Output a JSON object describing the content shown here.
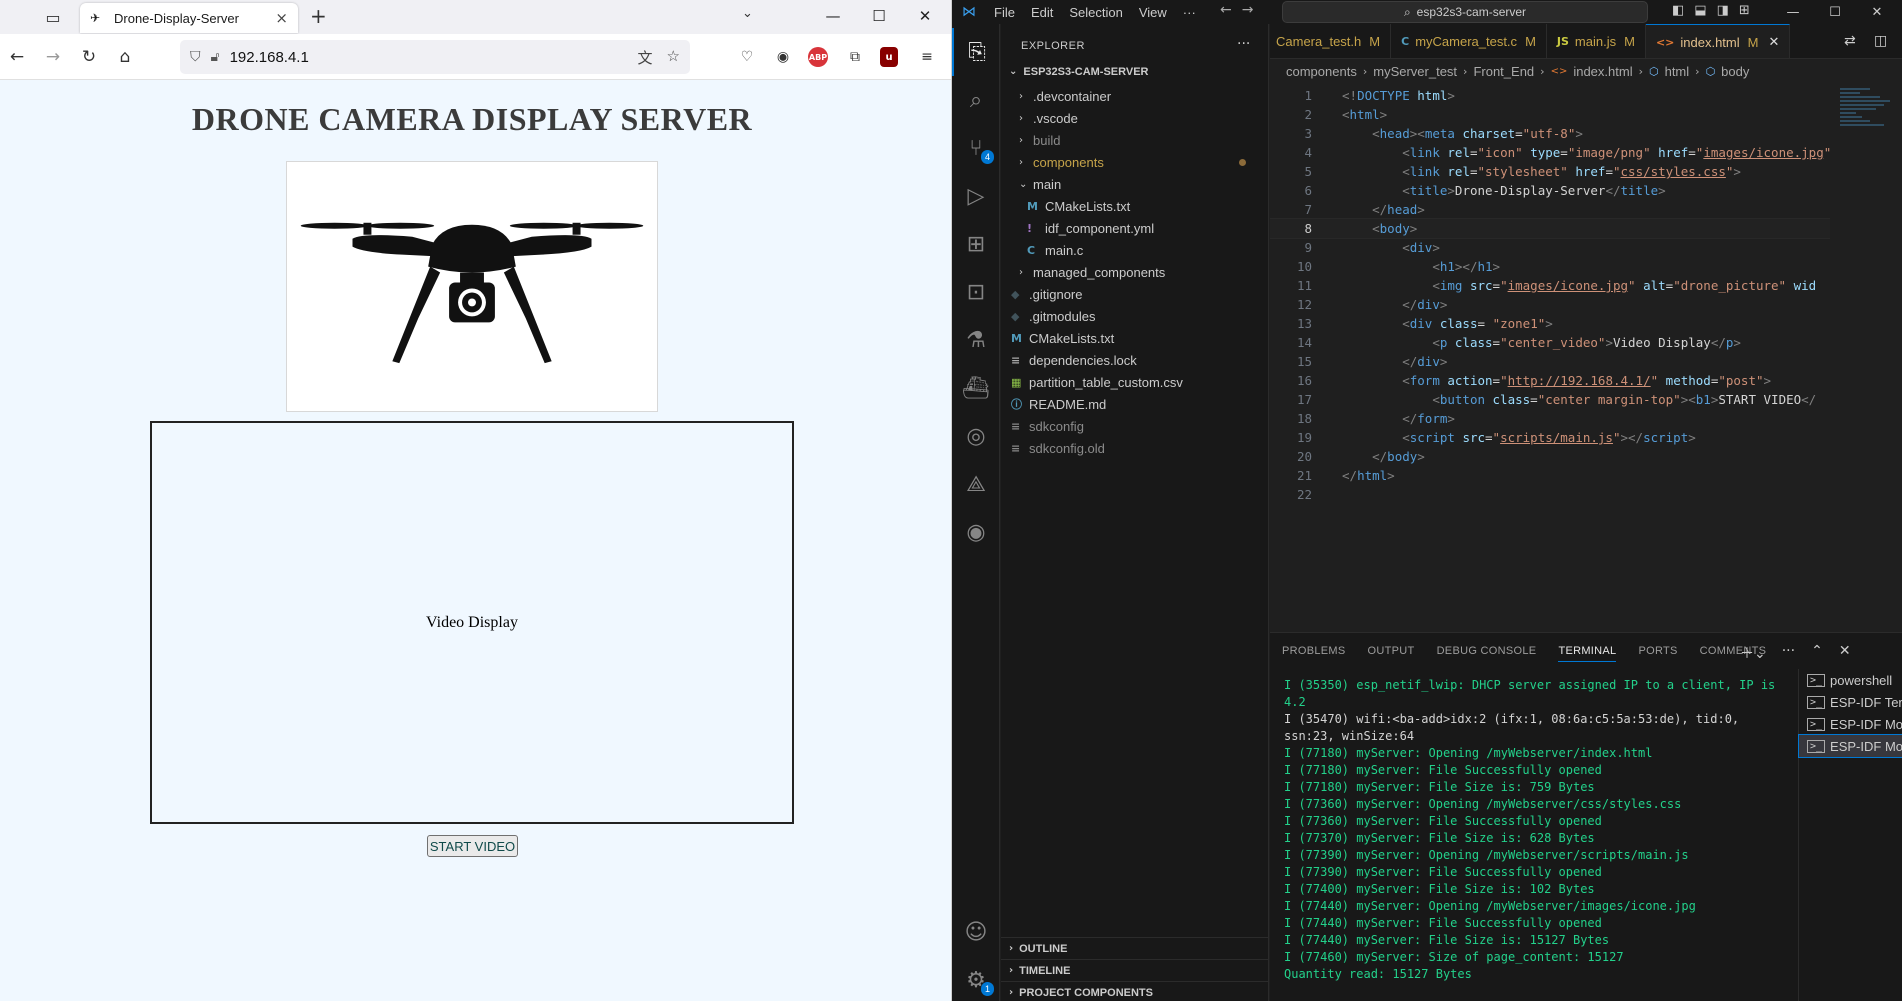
{
  "browser": {
    "tab_title": "Drone-Display-Server",
    "url": "192.168.4.1",
    "page": {
      "heading": "DRONE CAMERA DISPLAY SERVER",
      "video_text": "Video Display",
      "button_label": "START VIDEO"
    }
  },
  "vscode": {
    "menu": [
      "File",
      "Edit",
      "Selection",
      "View",
      "···"
    ],
    "command_center": "esp32s3-cam-server",
    "explorer": {
      "title": "EXPLORER",
      "root": "ESP32S3-CAM-SERVER",
      "items": [
        {
          "label": ".devcontainer",
          "type": "folder"
        },
        {
          "label": ".vscode",
          "type": "folder"
        },
        {
          "label": "build",
          "type": "folder"
        },
        {
          "label": "components",
          "type": "folder"
        },
        {
          "label": "main",
          "type": "folder-open"
        },
        {
          "label": "CMakeLists.txt",
          "type": "file",
          "icon": "M"
        },
        {
          "label": "idf_component.yml",
          "type": "file",
          "icon": "!"
        },
        {
          "label": "main.c",
          "type": "file",
          "icon": "C"
        },
        {
          "label": "managed_components",
          "type": "folder"
        },
        {
          "label": ".gitignore",
          "type": "file",
          "icon": "◆"
        },
        {
          "label": ".gitmodules",
          "type": "file",
          "icon": "◆"
        },
        {
          "label": "CMakeLists.txt",
          "type": "file",
          "icon": "M"
        },
        {
          "label": "dependencies.lock",
          "type": "file",
          "icon": "≡"
        },
        {
          "label": "partition_table_custom.csv",
          "type": "file",
          "icon": "▦"
        },
        {
          "label": "README.md",
          "type": "file",
          "icon": "ⓘ"
        },
        {
          "label": "sdkconfig",
          "type": "file",
          "icon": "≡"
        },
        {
          "label": "sdkconfig.old",
          "type": "file",
          "icon": "≡"
        }
      ],
      "sections": [
        "OUTLINE",
        "TIMELINE",
        "PROJECT COMPONENTS"
      ]
    },
    "badges": {
      "source_control": "4",
      "settings": "1"
    },
    "tabs": [
      {
        "label": "Camera_test.h",
        "icon": "",
        "status": "M"
      },
      {
        "label": "myCamera_test.c",
        "icon": "C",
        "status": "M"
      },
      {
        "label": "main.js",
        "icon": "JS",
        "status": "M"
      },
      {
        "label": "index.html",
        "icon": "<>",
        "status": "M"
      }
    ],
    "breadcrumb": [
      "components",
      "myServer_test",
      "Front_End",
      "index.html",
      "html",
      "body"
    ],
    "code_lines": [
      {
        "n": "1",
        "html": "<span class='ba'>&lt;!</span><span class='tg'>DOCTYPE</span> <span class='at'>html</span><span class='ba'>&gt;</span>"
      },
      {
        "n": "2",
        "html": "<span class='ba'>&lt;</span><span class='tg'>html</span><span class='ba'>&gt;</span>"
      },
      {
        "n": "3",
        "html": "    <span class='ba'>&lt;</span><span class='tg'>head</span><span class='ba'>&gt;&lt;</span><span class='tg'>meta</span> <span class='at'>charset</span><span class='tx'>=</span><span class='sv'>\"utf-8\"</span><span class='ba'>&gt;</span>"
      },
      {
        "n": "4",
        "html": "        <span class='ba'>&lt;</span><span class='tg'>link</span> <span class='at'>rel</span><span class='tx'>=</span><span class='sv'>\"icon\"</span> <span class='at'>type</span><span class='tx'>=</span><span class='sv'>\"image/png\"</span> <span class='at'>href</span><span class='tx'>=</span><span class='sv'>\"<span class='ul'>images/icone.jpg</span>\"</span>"
      },
      {
        "n": "5",
        "html": "        <span class='ba'>&lt;</span><span class='tg'>link</span> <span class='at'>rel</span><span class='tx'>=</span><span class='sv'>\"stylesheet\"</span> <span class='at'>href</span><span class='tx'>=</span><span class='sv'>\"<span class='ul'>css/styles.css</span>\"</span><span class='ba'>&gt;</span>"
      },
      {
        "n": "6",
        "html": "        <span class='ba'>&lt;</span><span class='tg'>title</span><span class='ba'>&gt;</span><span class='tx'>Drone-Display-Server</span><span class='ba'>&lt;/</span><span class='tg'>title</span><span class='ba'>&gt;</span>"
      },
      {
        "n": "7",
        "html": "    <span class='ba'>&lt;/</span><span class='tg'>head</span><span class='ba'>&gt;</span>"
      },
      {
        "n": "8",
        "html": "    <span class='ba'>&lt;</span><span class='tg'>body</span><span class='ba'>&gt;</span>"
      },
      {
        "n": "9",
        "html": "        <span class='ba'>&lt;</span><span class='tg'>div</span><span class='ba'>&gt;</span>"
      },
      {
        "n": "10",
        "html": "            <span class='ba'>&lt;</span><span class='tg'>h1</span><span class='ba'>&gt;&lt;/</span><span class='tg'>h1</span><span class='ba'>&gt;</span>"
      },
      {
        "n": "11",
        "html": "            <span class='ba'>&lt;</span><span class='tg'>img</span> <span class='at'>src</span><span class='tx'>=</span><span class='sv'>\"<span class='ul'>images/icone.jpg</span>\"</span> <span class='at'>alt</span><span class='tx'>=</span><span class='sv'>\"drone_picture\"</span> <span class='at'>wid</span>"
      },
      {
        "n": "12",
        "html": "        <span class='ba'>&lt;/</span><span class='tg'>div</span><span class='ba'>&gt;</span>"
      },
      {
        "n": "13",
        "html": "        <span class='ba'>&lt;</span><span class='tg'>div</span> <span class='at'>class</span><span class='tx'>= </span><span class='sv'>\"zone1\"</span><span class='ba'>&gt;</span>"
      },
      {
        "n": "14",
        "html": "            <span class='ba'>&lt;</span><span class='tg'>p</span> <span class='at'>class</span><span class='tx'>=</span><span class='sv'>\"center_video\"</span><span class='ba'>&gt;</span><span class='tx'>Video Display</span><span class='ba'>&lt;/</span><span class='tg'>p</span><span class='ba'>&gt;</span>"
      },
      {
        "n": "15",
        "html": "        <span class='ba'>&lt;/</span><span class='tg'>div</span><span class='ba'>&gt;</span>"
      },
      {
        "n": "16",
        "html": "        <span class='ba'>&lt;</span><span class='tg'>form</span> <span class='at'>action</span><span class='tx'>=</span><span class='sv'>\"<span class='ul'>http://192.168.4.1/</span>\"</span> <span class='at'>method</span><span class='tx'>=</span><span class='sv'>\"post\"</span><span class='ba'>&gt;</span>"
      },
      {
        "n": "17",
        "html": "            <span class='ba'>&lt;</span><span class='tg'>button</span> <span class='at'>class</span><span class='tx'>=</span><span class='sv'>\"center margin-top\"</span><span class='ba'>&gt;&lt;</span><span class='tg'>b1</span><span class='ba'>&gt;</span><span class='tx'>START VIDEO</span><span class='ba'>&lt;/</span>"
      },
      {
        "n": "18",
        "html": "        <span class='ba'>&lt;/</span><span class='tg'>form</span><span class='ba'>&gt;</span>"
      },
      {
        "n": "19",
        "html": "        <span class='ba'>&lt;</span><span class='tg'>script</span> <span class='at'>src</span><span class='tx'>=</span><span class='sv'>\"<span class='ul'>scripts/main.js</span>\"</span><span class='ba'>&gt;&lt;/</span><span class='tg'>script</span><span class='ba'>&gt;</span>"
      },
      {
        "n": "20",
        "html": "    <span class='ba'>&lt;/</span><span class='tg'>body</span><span class='ba'>&gt;</span>"
      },
      {
        "n": "21",
        "html": "<span class='ba'>&lt;/</span><span class='tg'>html</span><span class='ba'>&gt;</span>"
      },
      {
        "n": "22",
        "html": ""
      }
    ],
    "current_line": "8",
    "panel_tabs": [
      "PROBLEMS",
      "OUTPUT",
      "DEBUG CONSOLE",
      "TERMINAL",
      "PORTS",
      "COMMENTS"
    ],
    "active_panel_tab": "TERMINAL",
    "terminal_lines": [
      {
        "text": "I (35350) esp_netif_lwip: DHCP server assigned IP to a client, IP is 4.2",
        "style": "g"
      },
      {
        "text": "I (35470) wifi:<ba-add>idx:2 (ifx:1, 08:6a:c5:5a:53:de), tid:0, ssn:23, winSize:64",
        "style": "w"
      },
      {
        "text": "I (77180) myServer: Opening /myWebserver/index.html",
        "style": "g"
      },
      {
        "text": "I (77180) myServer: File Successfully opened",
        "style": "g"
      },
      {
        "text": "I (77180) myServer: File Size is: 759 Bytes",
        "style": "g"
      },
      {
        "text": "I (77360) myServer: Opening /myWebserver/css/styles.css",
        "style": "g"
      },
      {
        "text": "I (77360) myServer: File Successfully opened",
        "style": "g"
      },
      {
        "text": "I (77370) myServer: File Size is: 628 Bytes",
        "style": "g"
      },
      {
        "text": "I (77390) myServer: Opening /myWebserver/scripts/main.js",
        "style": "g"
      },
      {
        "text": "I (77390) myServer: File Successfully opened",
        "style": "g"
      },
      {
        "text": "I (77400) myServer: File Size is: 102 Bytes",
        "style": "g"
      },
      {
        "text": "I (77440) myServer: Opening /myWebserver/images/icone.jpg",
        "style": "g"
      },
      {
        "text": "I (77440) myServer: File Successfully opened",
        "style": "g"
      },
      {
        "text": "I (77440) myServer: File Size is: 15127 Bytes",
        "style": "g"
      },
      {
        "text": "I (77460) myServer: Size of page_content: 15127",
        "style": "g"
      },
      {
        "text": "Quantity read: 15127 Bytes",
        "style": "g"
      }
    ],
    "terminals": [
      {
        "label": "powershell"
      },
      {
        "label": "ESP-IDF Ter..."
      },
      {
        "label": "ESP-IDF Mo..."
      },
      {
        "label": "ESP-IDF Mo..."
      }
    ]
  }
}
